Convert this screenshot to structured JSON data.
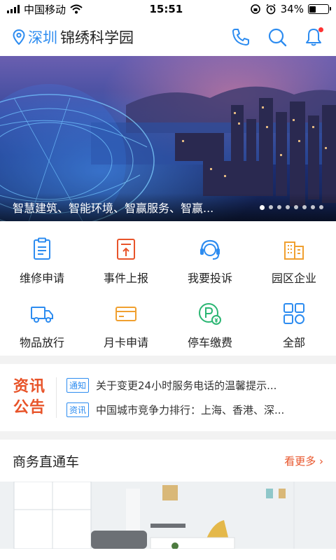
{
  "status": {
    "carrier": "中国移动",
    "time": "15:51",
    "battery": "34%",
    "battery_level": 0.34
  },
  "header": {
    "city": "深圳",
    "park": "锦绣科学园",
    "icons": [
      "location-pin-icon",
      "phone-icon",
      "search-icon",
      "bell-icon"
    ]
  },
  "banner": {
    "caption": "智慧建筑、智能环境、智赢服务、智赢...",
    "slide_count": 8,
    "active_slide": 0
  },
  "services": [
    {
      "label": "维修申请",
      "icon": "repair-form-icon"
    },
    {
      "label": "事件上报",
      "icon": "report-upload-icon"
    },
    {
      "label": "我要投诉",
      "icon": "headset-icon"
    },
    {
      "label": "园区企业",
      "icon": "buildings-icon"
    },
    {
      "label": "物品放行",
      "icon": "truck-icon"
    },
    {
      "label": "月卡申请",
      "icon": "card-icon"
    },
    {
      "label": "停车缴费",
      "icon": "parking-pay-icon"
    },
    {
      "label": "全部",
      "icon": "all-grid-icon"
    }
  ],
  "news": {
    "logo_line1": "资讯",
    "logo_line2": "公告",
    "items": [
      {
        "tag": "通知",
        "text": "关于变更24小时服务电话的温馨提示..."
      },
      {
        "tag": "资讯",
        "text": "中国城市竞争力排行：上海、香港、深..."
      }
    ]
  },
  "business": {
    "title": "商务直通车",
    "more": "看更多 ›"
  },
  "colors": {
    "accent": "#2d8cf0",
    "orange": "#e8542a"
  }
}
